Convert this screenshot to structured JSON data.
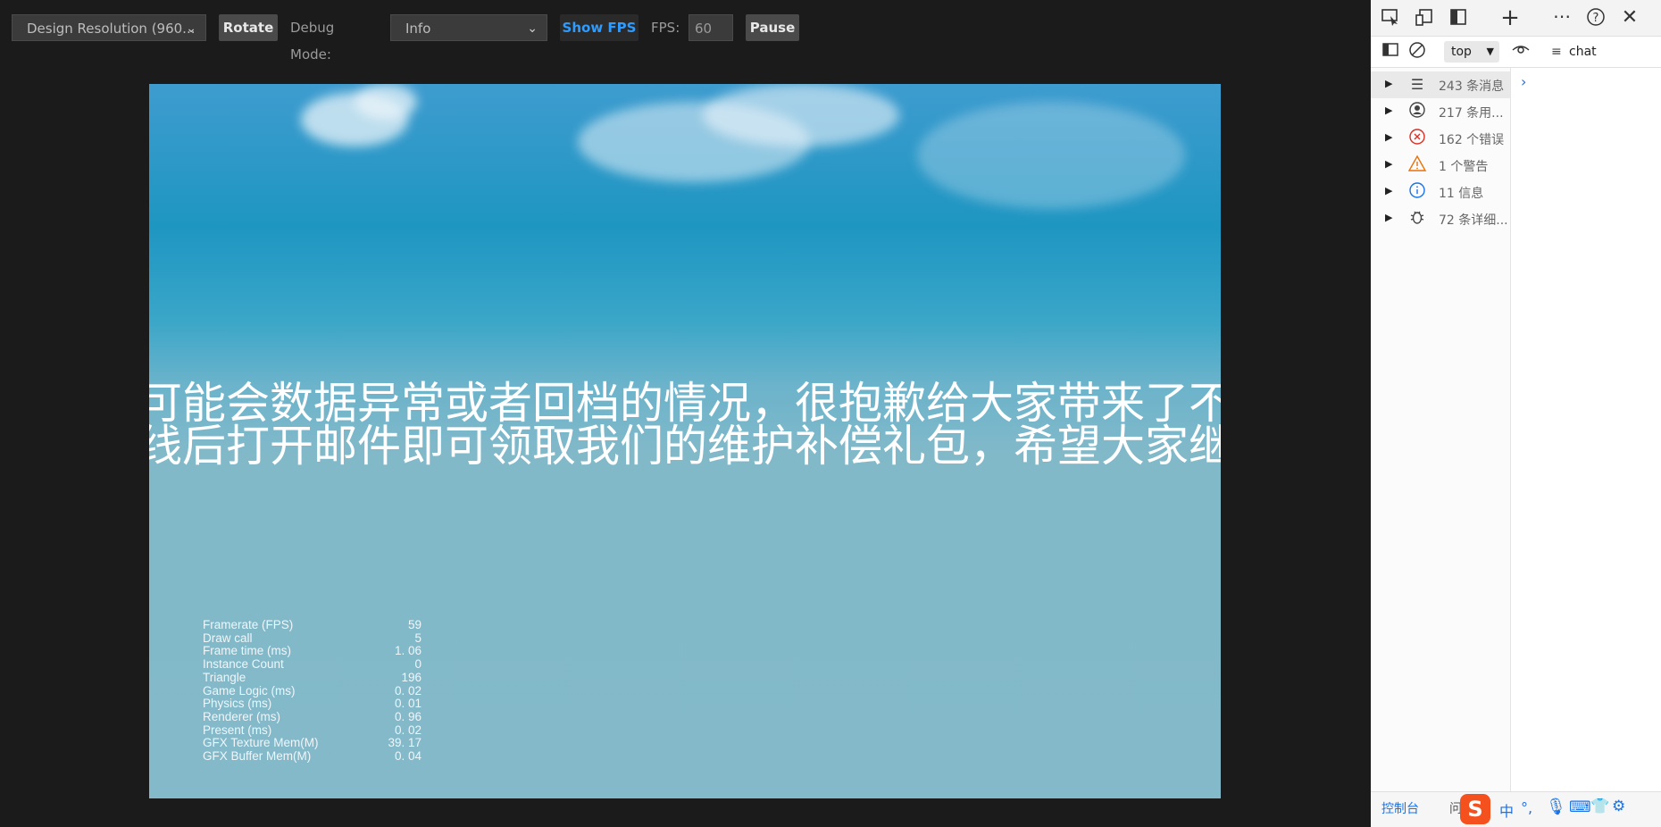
{
  "toolbar": {
    "resolution_value": "Design Resolution (960...",
    "rotate_label": "Rotate",
    "debug_mode_label": "Debug Mode:",
    "debug_mode_value": "Info",
    "show_fps_label": "Show FPS",
    "fps_label": "FPS:",
    "fps_value": "60",
    "pause_label": "Pause"
  },
  "game": {
    "marquee_line1": "可能会数据异常或者回档的情况，很抱歉给大家带来了不",
    "marquee_line2": "线后打开邮件即可领取我们的维护补偿礼包，希望大家继",
    "stats": [
      {
        "label": "Framerate (FPS)",
        "value": "59"
      },
      {
        "label": "Draw call",
        "value": "5"
      },
      {
        "label": "Frame time (ms)",
        "value": "1. 06"
      },
      {
        "label": "Instance Count",
        "value": "0"
      },
      {
        "label": "Triangle",
        "value": "196"
      },
      {
        "label": "Game Logic (ms)",
        "value": "0. 02"
      },
      {
        "label": "Physics (ms)",
        "value": "0. 01"
      },
      {
        "label": "Renderer (ms)",
        "value": "0. 96"
      },
      {
        "label": "Present (ms)",
        "value": "0. 02"
      },
      {
        "label": "GFX Texture Mem(M)",
        "value": "39. 17"
      },
      {
        "label": "GFX Buffer Mem(M)",
        "value": "0. 04"
      }
    ]
  },
  "devtools": {
    "context_value": "top",
    "filter_value": "chat",
    "sidebar": [
      {
        "icon": "list-icon",
        "text": "243 条消息"
      },
      {
        "icon": "user-icon",
        "text": "217 条用..."
      },
      {
        "icon": "error-icon",
        "text": "162 个错误"
      },
      {
        "icon": "warning-icon",
        "text": "1 个警告"
      },
      {
        "icon": "info-icon",
        "text": "11 信息"
      },
      {
        "icon": "bug-icon",
        "text": "72 条详细..."
      }
    ],
    "bottom_tab_console": "控制台",
    "bottom_tab_issues": "问",
    "ime": {
      "mode": "中",
      "punct": "°,"
    }
  },
  "colors": {
    "accent_blue": "#2e9bff",
    "error_red": "#d93025",
    "warning_orange": "#e8710a",
    "info_blue": "#1a73e8"
  }
}
